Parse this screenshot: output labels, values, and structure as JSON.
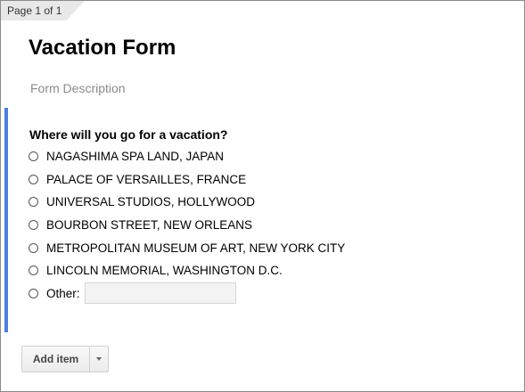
{
  "page_indicator": "Page 1 of 1",
  "form": {
    "title": "Vacation Form",
    "description_placeholder": "Form Description"
  },
  "question": {
    "title": "Where will you go for a vacation?",
    "options": [
      "NAGASHIMA SPA LAND, JAPAN",
      "PALACE OF VERSAILLES, FRANCE",
      "UNIVERSAL STUDIOS, HOLLYWOOD",
      "BOURBON STREET, NEW ORLEANS",
      "METROPOLITAN MUSEUM OF ART, NEW YORK CITY",
      "LINCOLN MEMORIAL, WASHINGTON D.C."
    ],
    "other_label": "Other:",
    "other_value": ""
  },
  "toolbar": {
    "add_item_label": "Add item",
    "dropdown_icon": "caret-down-icon"
  },
  "colors": {
    "active_bar": "#4d7fdb",
    "page_tab": "#e8e8e8"
  }
}
